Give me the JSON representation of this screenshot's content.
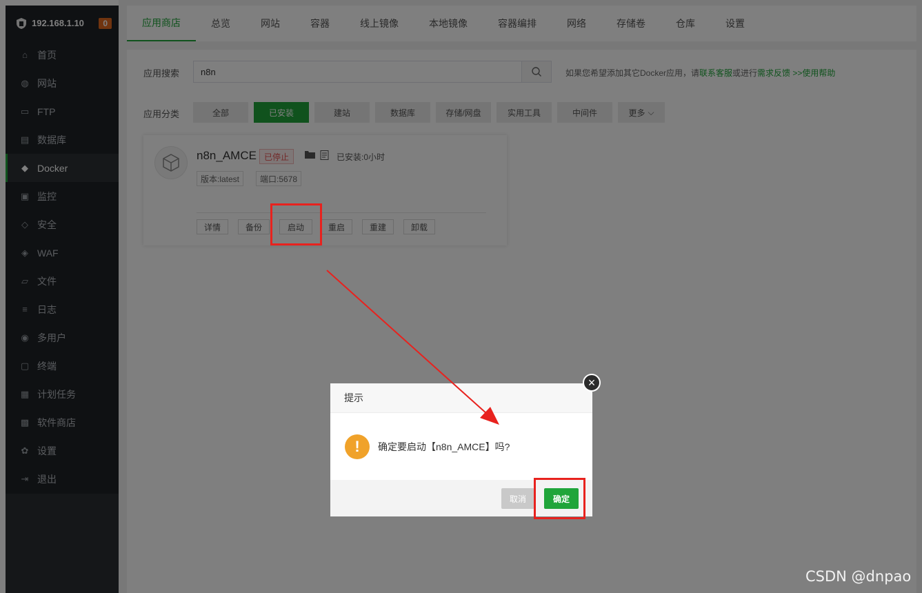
{
  "sidebar": {
    "host": "192.168.1.10",
    "badge": "0",
    "items": [
      {
        "label": "首页",
        "icon": "home-icon"
      },
      {
        "label": "网站",
        "icon": "globe-icon"
      },
      {
        "label": "FTP",
        "icon": "ftp-icon"
      },
      {
        "label": "数据库",
        "icon": "database-icon"
      },
      {
        "label": "Docker",
        "icon": "docker-icon",
        "active": true
      },
      {
        "label": "监控",
        "icon": "monitor-icon"
      },
      {
        "label": "安全",
        "icon": "shield-icon"
      },
      {
        "label": "WAF",
        "icon": "waf-shield-icon"
      },
      {
        "label": "文件",
        "icon": "folder-icon"
      },
      {
        "label": "日志",
        "icon": "log-icon"
      },
      {
        "label": "多用户",
        "icon": "users-icon"
      },
      {
        "label": "终端",
        "icon": "terminal-icon"
      },
      {
        "label": "计划任务",
        "icon": "calendar-icon"
      },
      {
        "label": "软件商店",
        "icon": "grid-icon"
      },
      {
        "label": "设置",
        "icon": "gear-icon"
      },
      {
        "label": "退出",
        "icon": "logout-icon"
      }
    ]
  },
  "topnav": {
    "tabs": [
      "应用商店",
      "总览",
      "网站",
      "容器",
      "线上镜像",
      "本地镜像",
      "容器编排",
      "网络",
      "存储卷",
      "仓库",
      "设置"
    ],
    "active": 0
  },
  "search": {
    "label": "应用搜索",
    "value": "n8n",
    "hint_prefix": "如果您希望添加其它Docker应用，请",
    "hint_link1": "联系客服",
    "hint_mid": "或进行",
    "hint_link2": "需求反馈 >>",
    "hint_link3": "使用帮助"
  },
  "categories": {
    "label": "应用分类",
    "items": [
      "全部",
      "已安装",
      "建站",
      "数据库",
      "存储/网盘",
      "实用工具",
      "中间件",
      "更多"
    ],
    "active": 1
  },
  "app_card": {
    "name": "n8n_AMCE",
    "status": "已停止",
    "installed": "已安装:0小时",
    "version": "版本:latest",
    "port": "端口:5678",
    "actions": [
      "详情",
      "备份",
      "启动",
      "重启",
      "重建",
      "卸载"
    ]
  },
  "dialog": {
    "title": "提示",
    "message": "确定要启动【n8n_AMCE】吗?",
    "cancel": "取消",
    "confirm": "确定"
  },
  "watermark": "CSDN @dnpao",
  "colors": {
    "accent": "#20a53a",
    "highlight": "#e8221e",
    "warning": "#f0a22a"
  }
}
